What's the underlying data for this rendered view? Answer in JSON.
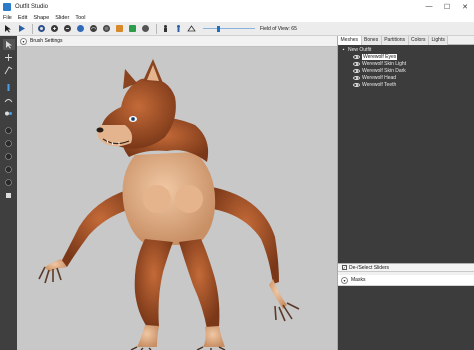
{
  "window": {
    "title": "Outfit Studio",
    "controls": {
      "minimize": "—",
      "maximize": "☐",
      "close": "✕"
    }
  },
  "menu": [
    "File",
    "Edit",
    "Shape",
    "Slider",
    "Tool"
  ],
  "toolbar": {
    "fov_label": "Field of View: 65",
    "fov_level": 0.3,
    "buttons": [
      "select-tool",
      "transform-tool",
      "mask-brush",
      "inflate-brush",
      "deflate-brush",
      "move-brush",
      "smooth-brush",
      "weight-brush",
      "color-brush",
      "alpha-brush",
      "collision-brush",
      "view-front",
      "view-side",
      "view-perspective"
    ]
  },
  "left_tools": [
    "select-tool-icon",
    "move-tool-icon",
    "inflate-tool-icon",
    "deflate-tool-icon",
    "smooth-tool-icon",
    "undiff-tool-icon",
    "color-tool-icon",
    "alpha-tool-icon",
    "sphere-view-icon",
    "wireframe-icon",
    "light-icon",
    "mirror-icon"
  ],
  "viewport": {
    "brush_settings_label": "Brush Settings",
    "background_color": "#c8c8c8"
  },
  "right_panel": {
    "tabs": [
      "Meshes",
      "Bones",
      "Partitions",
      "Colors",
      "Lights"
    ],
    "active_tab": "Meshes",
    "tree": {
      "root_label": "New Outfit",
      "meshes": [
        {
          "label": "Werewolf Eyes",
          "selected": true
        },
        {
          "label": "Werewolf Skin Light",
          "selected": false
        },
        {
          "label": "Werewolf Skin Dark",
          "selected": false
        },
        {
          "label": "Werewolf Head",
          "selected": false
        },
        {
          "label": "Werewolf Teeth",
          "selected": false
        }
      ]
    },
    "sliders_header": "De-/Select Sliders",
    "masks_label": "Masks"
  },
  "colors": {
    "panel_dark": "#3c3c3c",
    "toolbar_dark": "#3f3f3f",
    "fur": "#a4522a",
    "skin": "#e2b08a",
    "accent": "#1f6fbf"
  }
}
